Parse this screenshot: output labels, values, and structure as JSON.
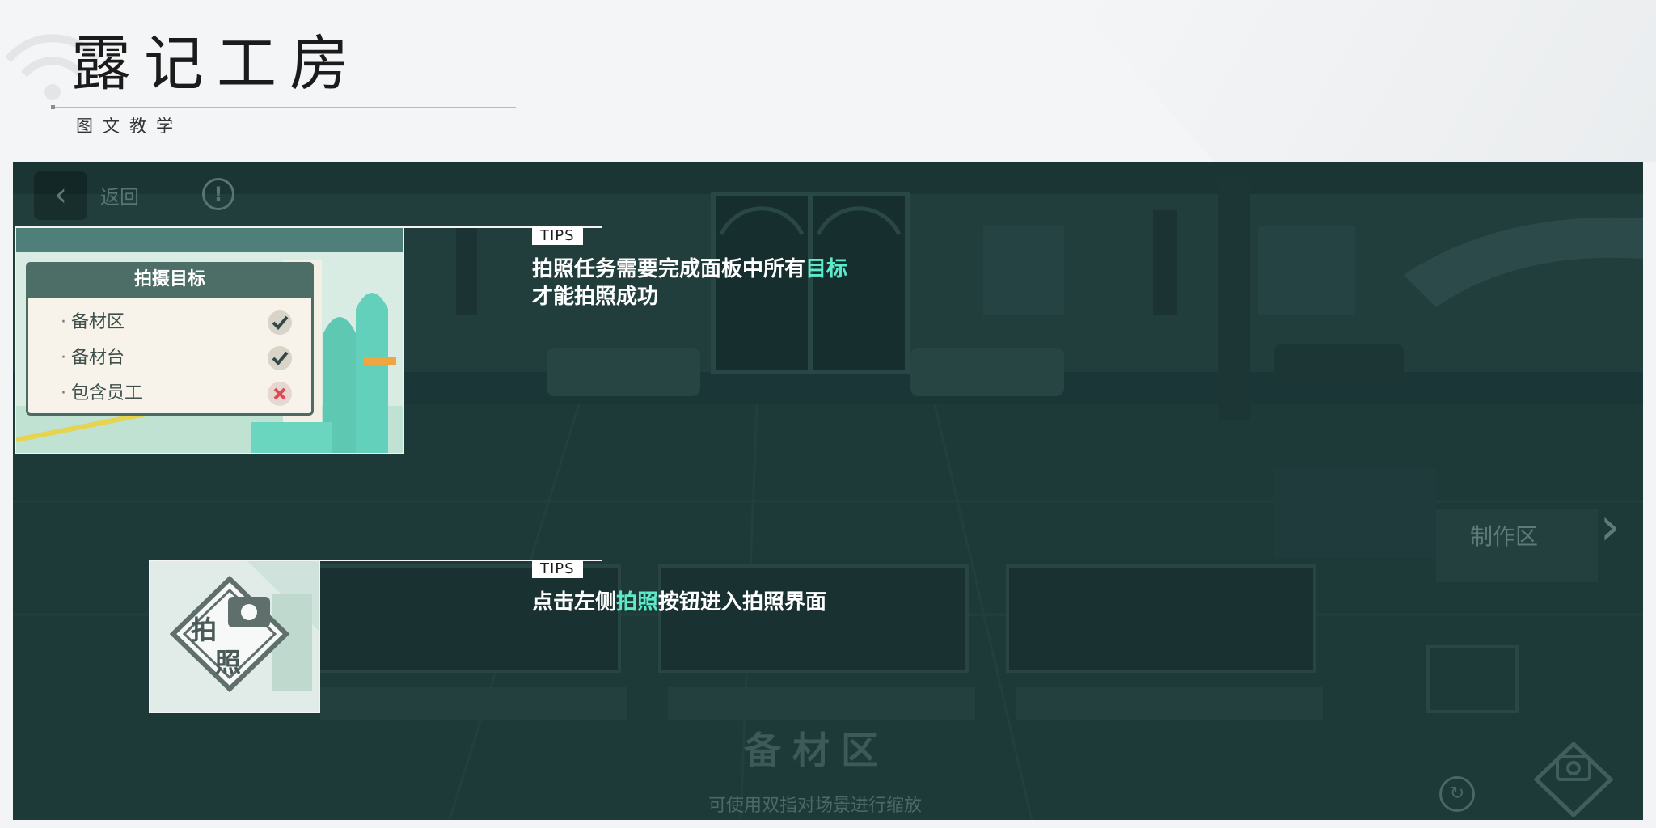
{
  "header": {
    "title": "露记工房",
    "subtitle": "图文教学"
  },
  "game_ui": {
    "back_label": "返回",
    "info_symbol": "!",
    "zone_label": "制作区",
    "bottom_chars": "备材区",
    "bottom_hint": "可使用双指对场景进行缩放"
  },
  "tips": [
    {
      "badge": "TIPS",
      "text_before": "拍照任务需要完成面板中所有",
      "highlight": "目标",
      "text_after": "",
      "line2": "才能拍照成功"
    },
    {
      "badge": "TIPS",
      "text_before": "点击左侧",
      "highlight": "拍照",
      "text_after": "按钮进入拍照界面",
      "line2": ""
    }
  ],
  "panel": {
    "title": "拍摄目标",
    "items": [
      {
        "label": "备材区",
        "status": "done"
      },
      {
        "label": "备材台",
        "status": "done"
      },
      {
        "label": "包含员工",
        "status": "missing"
      }
    ]
  },
  "photo_button": {
    "label_top": "拍",
    "label_bottom": "照"
  },
  "colors": {
    "highlight": "#5ee9c9",
    "scene_bg": "#233e3e",
    "panel_header": "#4d6e66"
  }
}
